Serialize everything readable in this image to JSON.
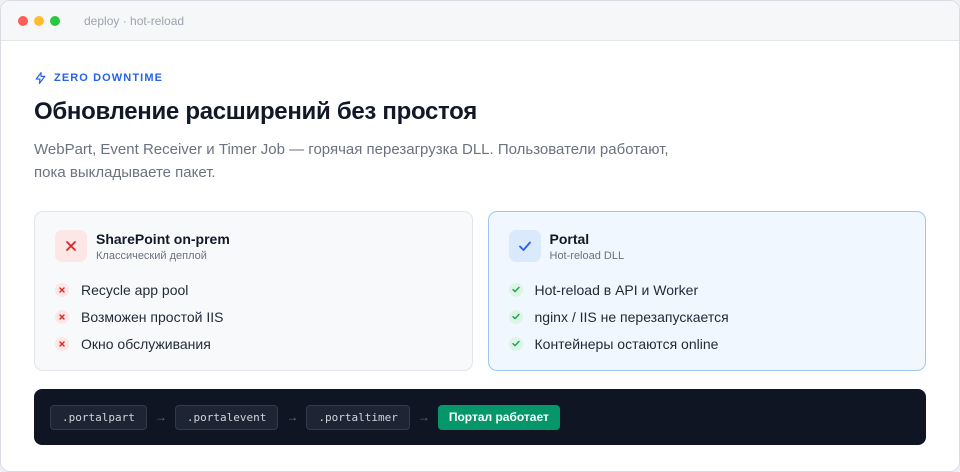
{
  "window": {
    "title": "deploy · hot-reload"
  },
  "header": {
    "eyebrow": "ZERO DOWNTIME",
    "title": "Обновление расширений без простоя",
    "subtitle_line1": "WebPart, Event Receiver и Timer Job — горячая перезагрузка DLL. Пользователи работают,",
    "subtitle_line2": "пока выкладываете пакет."
  },
  "cards": {
    "onprem": {
      "name": "SharePoint on-prem",
      "subtitle": "Классический деплой",
      "items": [
        "Recycle app pool",
        "Возможен простой IIS",
        "Окно обслуживания"
      ]
    },
    "portal": {
      "name": "Portal",
      "subtitle": "Hot-reload DLL",
      "items": [
        "Hot-reload в API и Worker",
        "nginx / IIS не перезапускается",
        "Контейнеры остаются online"
      ]
    }
  },
  "pipeline": {
    "steps": [
      ".portalpart",
      ".portalevent",
      ".portaltimer"
    ],
    "arrow": "→",
    "final": "Портал работает"
  },
  "colors": {
    "accent": "#2563eb",
    "negative": "#dc2626",
    "positive": "#16a34a",
    "success_button": "#059669",
    "pipeline_bg": "#0f1522"
  },
  "icons": {
    "eyebrow": "lightning-icon",
    "onprem_badge": "x-icon",
    "portal_badge": "check-icon"
  }
}
